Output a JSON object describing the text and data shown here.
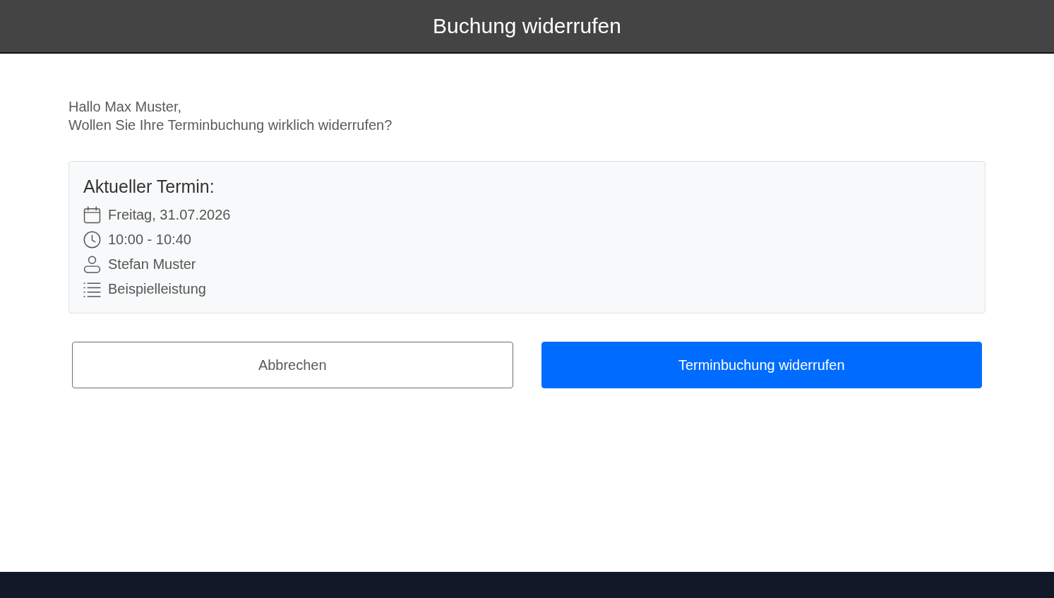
{
  "header": {
    "title": "Buchung widerrufen"
  },
  "message": {
    "greeting": "Hallo Max Muster,",
    "question": "Wollen Sie Ihre Terminbuchung wirklich widerrufen?"
  },
  "appointment": {
    "title": "Aktueller Termin:",
    "details": [
      {
        "kind": "date",
        "text": "Freitag, 31.07.2026"
      },
      {
        "kind": "time",
        "text": "10:00 - 10:40"
      },
      {
        "kind": "person",
        "text": "Stefan Muster"
      },
      {
        "kind": "service",
        "text": "Beispielleistung"
      }
    ]
  },
  "buttons": [
    {
      "kind": "secondary",
      "label": "Abbrechen"
    },
    {
      "kind": "primary",
      "label": "Terminbuchung widerrufen"
    }
  ]
}
